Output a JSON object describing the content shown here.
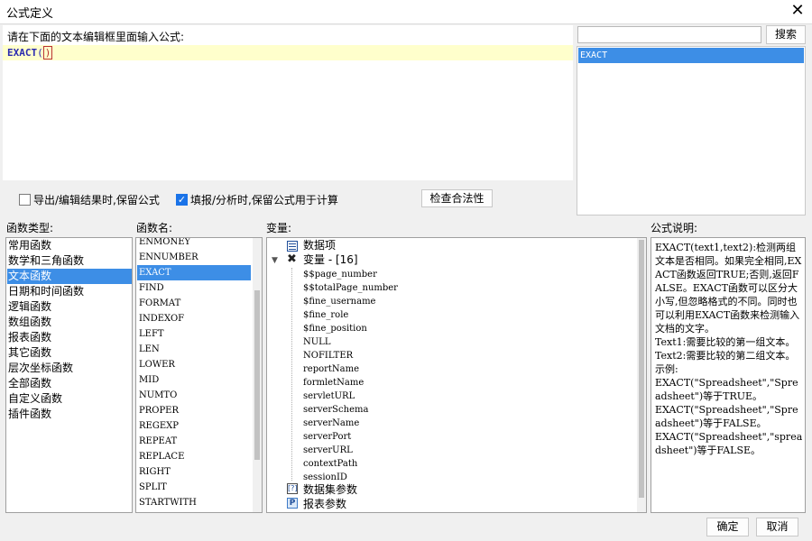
{
  "window": {
    "title": "公式定义"
  },
  "editor": {
    "hint": "请在下面的文本编辑框里面输入公式:",
    "formula_name": "EXACT",
    "open_paren": "(",
    "close_paren": ")"
  },
  "search": {
    "value": "",
    "button_label": "搜索",
    "results": [
      "EXACT"
    ]
  },
  "options": {
    "export_keep_formula": {
      "label": "导出/编辑结果时,保留公式",
      "checked": false
    },
    "fill_keep_formula": {
      "label": "填报/分析时,保留公式用于计算",
      "checked": true
    },
    "check_button": "检查合法性"
  },
  "function_types": {
    "header": "函数类型:",
    "items": [
      "常用函数",
      "数学和三角函数",
      "文本函数",
      "日期和时间函数",
      "逻辑函数",
      "数组函数",
      "报表函数",
      "其它函数",
      "层次坐标函数",
      "全部函数",
      "自定义函数",
      "插件函数"
    ],
    "selected": "文本函数"
  },
  "function_names": {
    "header": "函数名:",
    "items": [
      "ENMONEY",
      "ENNUMBER",
      "EXACT",
      "FIND",
      "FORMAT",
      "INDEXOF",
      "LEFT",
      "LEN",
      "LOWER",
      "MID",
      "NUMTO",
      "PROPER",
      "REGEXP",
      "REPEAT",
      "REPLACE",
      "RIGHT",
      "SPLIT",
      "STARTWITH"
    ],
    "selected": "EXACT"
  },
  "variables": {
    "header": "变量:",
    "data_items": "数据项",
    "variable_group": "变量 - [16]",
    "variable_items": [
      "$$page_number",
      "$$totalPage_number",
      "$fine_username",
      "$fine_role",
      "$fine_position",
      "NULL",
      "NOFILTER",
      "reportName",
      "formletName",
      "servletURL",
      "serverSchema",
      "serverName",
      "serverPort",
      "serverURL",
      "contextPath",
      "sessionID"
    ],
    "dataset_params": "数据集参数",
    "report_params": "报表参数"
  },
  "description": {
    "header": "公式说明:",
    "text": "EXACT(text1,text2):检测两组文本是否相同。如果完全相同,EXACT函数返回TRUE;否则,返回FALSE。EXACT函数可以区分大小写,但忽略格式的不同。同时也可以利用EXACT函数来检测输入文档的文字。\nText1:需要比较的第一组文本。\nText2:需要比较的第二组文本。\n示例:\nEXACT(\"Spreadsheet\",\"Spreadsheet\")等于TRUE。\nEXACT(\"Spreadsheet\",\"Spreadsheet\")等于FALSE。\nEXACT(\"Spreadsheet\",\"spreadsheet\")等于FALSE。"
  },
  "footer": {
    "ok_label": "确定",
    "cancel_label": "取消"
  }
}
